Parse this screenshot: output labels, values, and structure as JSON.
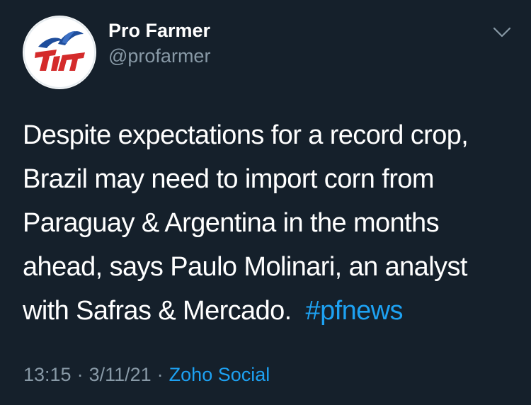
{
  "account": {
    "display_name": "Pro Farmer",
    "handle": "@profarmer",
    "avatar_icon": "pro-farmer-logo",
    "menu_icon": "chevron-down-icon"
  },
  "tweet": {
    "lines": [
      "Despite expectations for a record crop,",
      "Brazil may need to import corn from",
      "Paraguay & Argentina in the months",
      "ahead, says Paulo Molinari, an analyst",
      "with Safras & Mercado."
    ],
    "hashtag": "#pfnews"
  },
  "meta": {
    "time": "13:15",
    "separator": "·",
    "date": "3/11/21",
    "source": "Zoho Social"
  },
  "colors": {
    "background": "#15202b",
    "text": "#ffffff",
    "secondary": "#8899a6",
    "link": "#1da1f2",
    "logo_red": "#d42b2b",
    "logo_blue": "#1f4e9c"
  }
}
